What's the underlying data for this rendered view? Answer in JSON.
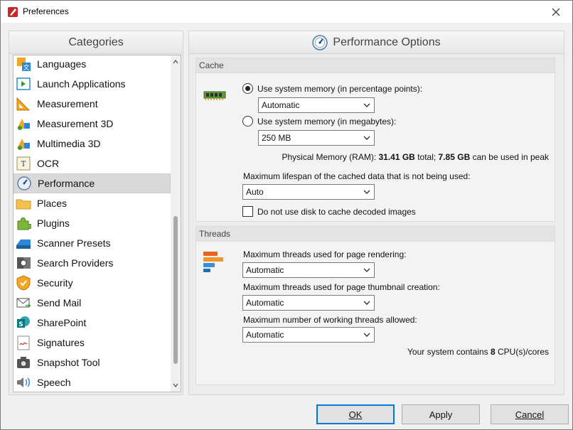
{
  "window": {
    "title": "Preferences"
  },
  "categories": {
    "header": "Categories",
    "items": [
      {
        "label": "Languages",
        "icon": "languages-icon"
      },
      {
        "label": "Launch Applications",
        "icon": "launch-applications-icon"
      },
      {
        "label": "Measurement",
        "icon": "measurement-icon"
      },
      {
        "label": "Measurement 3D",
        "icon": "measurement-3d-icon"
      },
      {
        "label": "Multimedia 3D",
        "icon": "multimedia-3d-icon"
      },
      {
        "label": "OCR",
        "icon": "ocr-icon"
      },
      {
        "label": "Performance",
        "icon": "performance-icon",
        "selected": true
      },
      {
        "label": "Places",
        "icon": "places-folder-icon"
      },
      {
        "label": "Plugins",
        "icon": "plugins-puzzle-icon"
      },
      {
        "label": "Scanner Presets",
        "icon": "scanner-icon"
      },
      {
        "label": "Search Providers",
        "icon": "search-providers-icon"
      },
      {
        "label": "Security",
        "icon": "security-shield-icon"
      },
      {
        "label": "Send Mail",
        "icon": "send-mail-icon"
      },
      {
        "label": "SharePoint",
        "icon": "sharepoint-icon"
      },
      {
        "label": "Signatures",
        "icon": "signatures-icon"
      },
      {
        "label": "Snapshot Tool",
        "icon": "snapshot-camera-icon"
      },
      {
        "label": "Speech",
        "icon": "speech-icon"
      }
    ]
  },
  "options": {
    "header": "Performance Options",
    "cache": {
      "title": "Cache",
      "radio_percent_label": "Use system memory (in percentage points):",
      "radio_percent_selected": true,
      "percent_select_value": "Automatic",
      "radio_mb_label": "Use system memory (in megabytes):",
      "radio_mb_selected": false,
      "mb_select_value": "250 MB",
      "physical_memory_prefix": "Physical Memory (RAM): ",
      "physical_memory_total": "31.41 GB",
      "physical_memory_mid": " total; ",
      "physical_memory_usable": "7.85 GB",
      "physical_memory_suffix": " can be used in peak",
      "lifespan_label": "Maximum lifespan of the cached data that is not being used:",
      "lifespan_select_value": "Auto",
      "disk_cache_label": "Do not use disk to cache decoded images",
      "disk_cache_checked": false
    },
    "threads": {
      "title": "Threads",
      "render_label": "Maximum threads used for page rendering:",
      "render_value": "Automatic",
      "thumbnail_label": "Maximum threads used for page thumbnail creation:",
      "thumbnail_value": "Automatic",
      "working_label": "Maximum number of working threads allowed:",
      "working_value": "Automatic",
      "cpu_prefix": "Your system contains ",
      "cpu_count": "8",
      "cpu_suffix": " CPU(s)/cores"
    }
  },
  "buttons": {
    "ok": "OK",
    "apply": "Apply",
    "cancel": "Cancel"
  },
  "colors": {
    "accent": "#0078d7",
    "selected_row": "#d9d9d9"
  }
}
